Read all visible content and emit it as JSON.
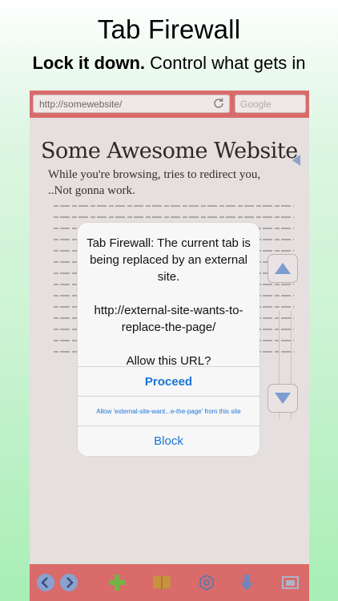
{
  "promo": {
    "title": "Tab Firewall",
    "subtitle_bold": "Lock it down.",
    "subtitle_rest": " Control what gets in"
  },
  "browser": {
    "url": "http://somewebsite/",
    "search_placeholder": "Google",
    "colors": {
      "bar": "#d96b6b",
      "dialog_link": "#1a74d8"
    }
  },
  "page": {
    "title": "Some Awesome Website",
    "line1": "While you're browsing, tries to redirect you,",
    "line2": "..Not gonna work."
  },
  "dialog": {
    "message": "Tab Firewall: The current tab is being replaced by an external site.\n\nhttp://external-site-wants-to-replace-the-page/\n\nAllow this URL?",
    "proceed": "Proceed",
    "allow_site": "Allow 'external-site-want...e-the-page' from this site",
    "block": "Block"
  },
  "toolbar_icons": [
    "back-icon",
    "forward-icon",
    "add-tab-icon",
    "bookmarks-icon",
    "settings-icon",
    "download-icon",
    "tabs-icon"
  ]
}
